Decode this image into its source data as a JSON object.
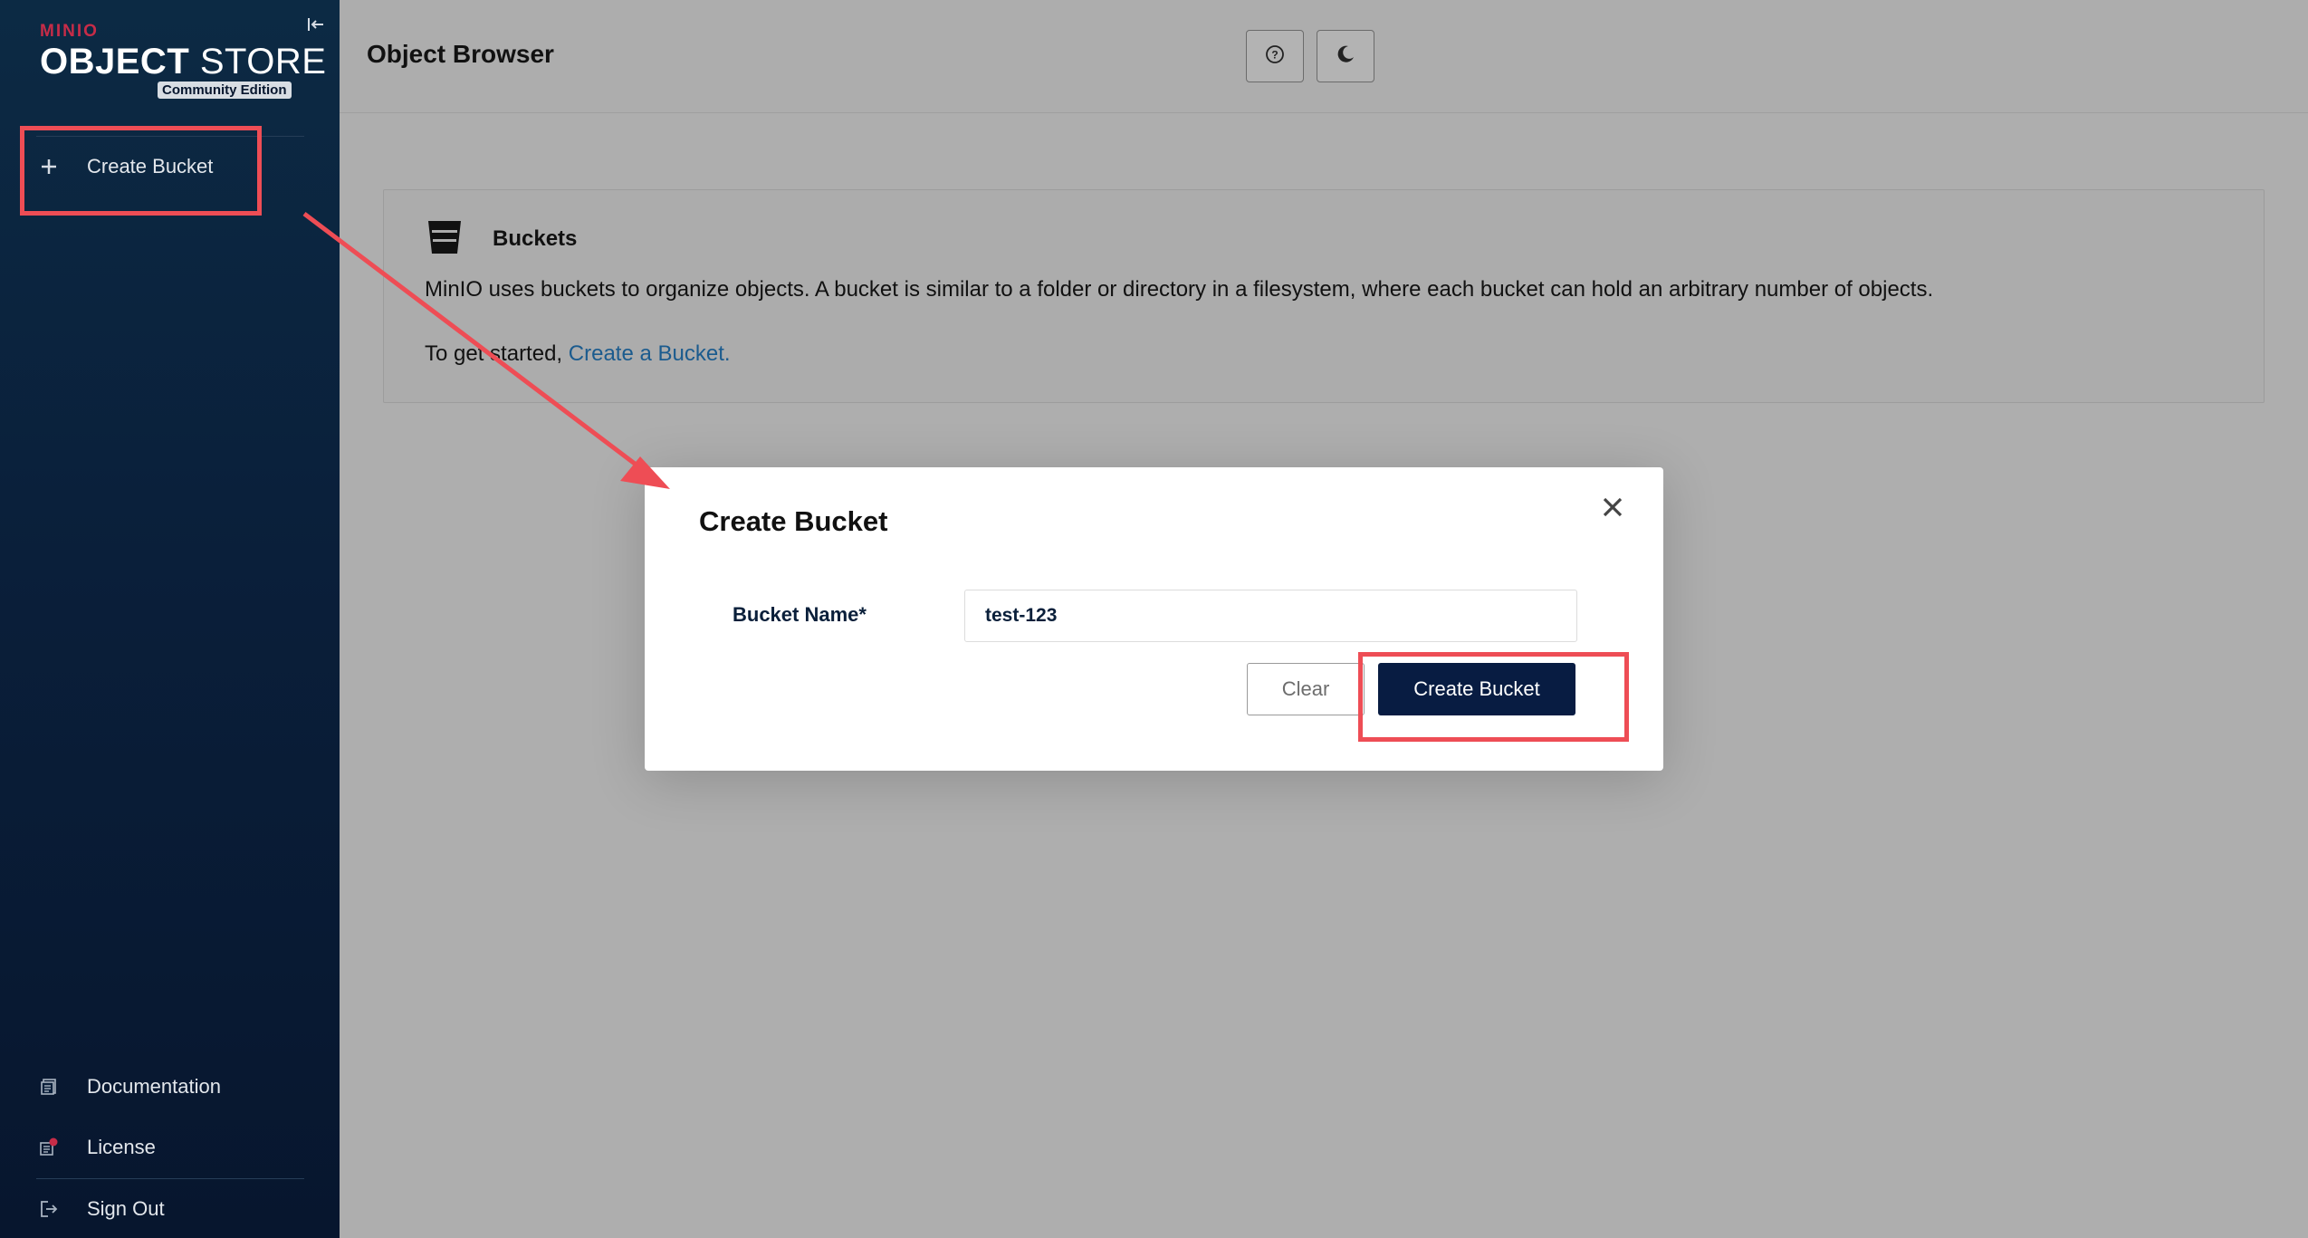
{
  "sidebar": {
    "brand_minio": "MINIO",
    "brand_store_bold": "OBJECT",
    "brand_store_thin": "STORE",
    "brand_edition": "Community Edition",
    "create_bucket_label": "Create Bucket",
    "bottom_items": [
      {
        "label": "Documentation",
        "icon": "document-icon"
      },
      {
        "label": "License",
        "icon": "license-icon"
      },
      {
        "label": "Sign Out",
        "icon": "sign-out-icon"
      }
    ]
  },
  "header": {
    "title": "Object Browser"
  },
  "info": {
    "title": "Buckets",
    "description": "MinIO uses buckets to organize objects. A bucket is similar to a folder or directory in a filesystem, where each bucket can hold an arbitrary number of objects.",
    "get_started": "To get started,",
    "create_link": "Create a Bucket."
  },
  "modal": {
    "title": "Create Bucket",
    "field_label": "Bucket Name*",
    "field_value": "test-123",
    "clear_label": "Clear",
    "create_label": "Create Bucket"
  },
  "colors": {
    "sidebar_bg": "#0a1f3a",
    "accent_red": "#c72c48",
    "primary_button": "#081c42",
    "link": "#1b5b8e",
    "annotation": "#ee4d55"
  }
}
